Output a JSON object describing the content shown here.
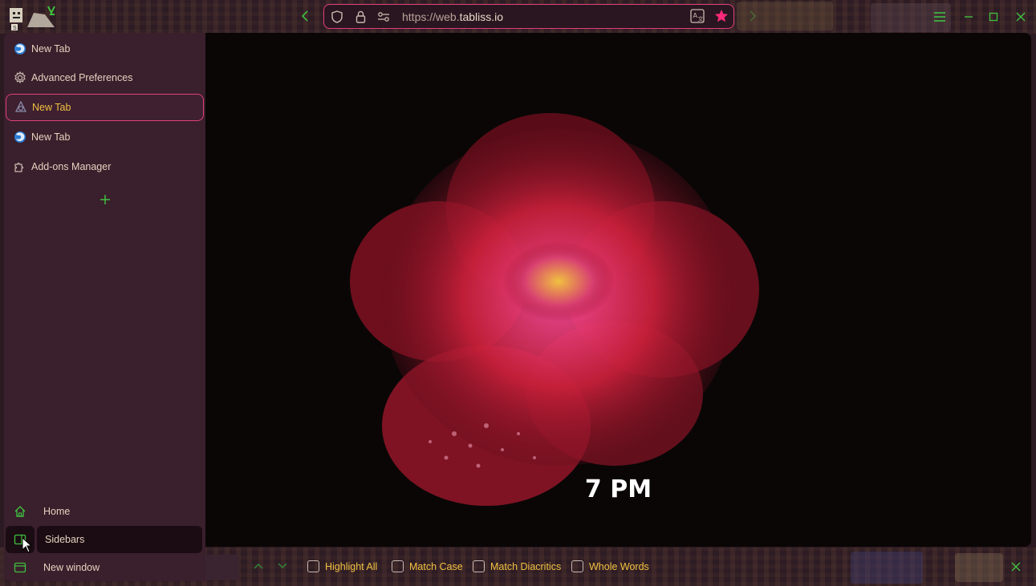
{
  "toolbar": {
    "back_icon": "chevron-left-icon",
    "forward_icon": "chevron-right-icon",
    "url_prefix": "https://web.",
    "url_domain": "tabliss.io"
  },
  "tabs": [
    {
      "label": "New Tab",
      "icon": "firefox-icon",
      "active": false
    },
    {
      "label": "Advanced Preferences",
      "icon": "gear-icon",
      "active": false
    },
    {
      "label": "New Tab",
      "icon": "tabliss-icon",
      "active": true
    },
    {
      "label": "New Tab",
      "icon": "firefox-icon",
      "active": false
    },
    {
      "label": "Add-ons Manager",
      "icon": "puzzle-icon",
      "active": false
    }
  ],
  "sidebar_bottom": {
    "home": "Home",
    "sidebars": "Sidebars",
    "new_window": "New window"
  },
  "content": {
    "time": "7 PM"
  },
  "findbar": {
    "highlight_all": "Highlight All",
    "match_case": "Match Case",
    "match_diacritics": "Match Diacritics",
    "whole_words": "Whole Words"
  },
  "colors": {
    "accent_green": "#3fbf3f",
    "accent_pink": "#e0407a",
    "active_text": "#f0c040",
    "sidebar_bg": "#3a1f2c"
  }
}
